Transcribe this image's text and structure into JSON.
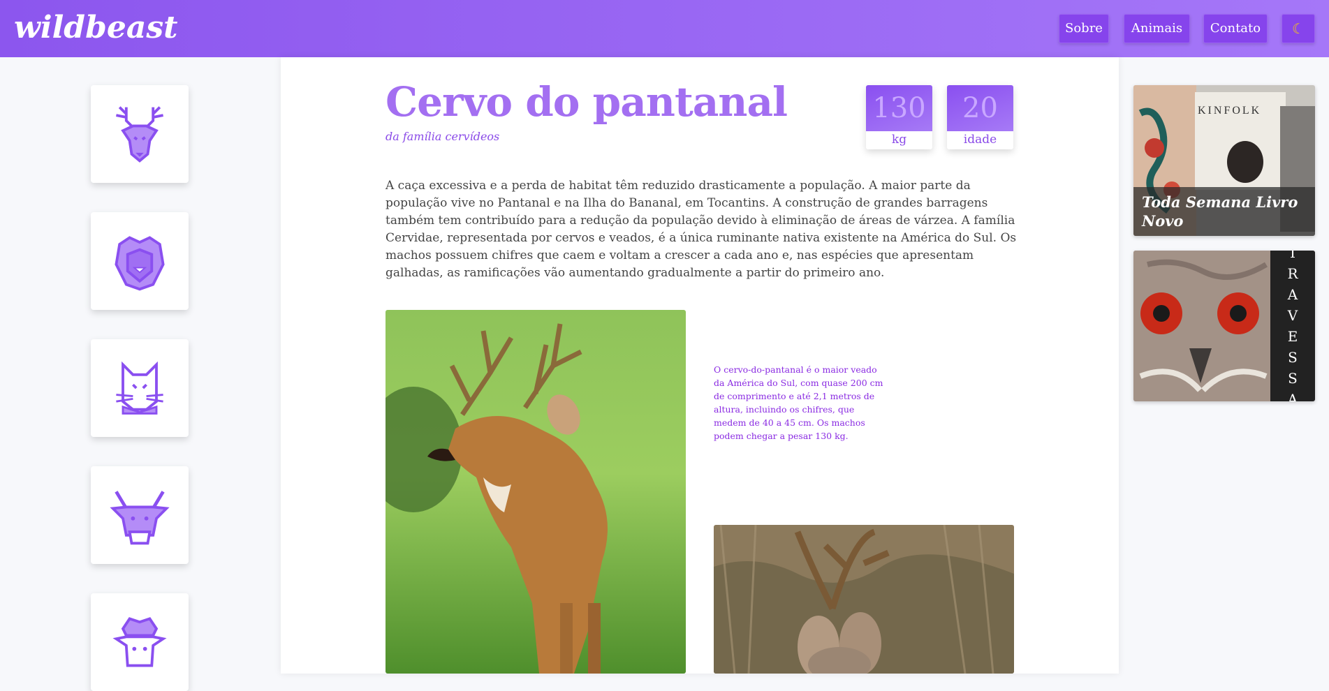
{
  "header": {
    "logo": "wildbeast",
    "nav": [
      {
        "label": "Sobre"
      },
      {
        "label": "Animais"
      },
      {
        "label": "Contato"
      }
    ],
    "theme_toggle_icon": "moon-icon",
    "colors": {
      "gradient_start": "#8c56ee",
      "gradient_end": "#a577f8",
      "accent": "#a36ff1"
    }
  },
  "sidebar": {
    "animals": [
      {
        "icon": "deer-icon"
      },
      {
        "icon": "lion-icon"
      },
      {
        "icon": "cat-icon"
      },
      {
        "icon": "bull-icon"
      },
      {
        "icon": "sheep-icon"
      }
    ]
  },
  "animal": {
    "title": "Cervo do pantanal",
    "subtitle": "da família cervídeos",
    "stats": [
      {
        "value": "130",
        "unit": "kg"
      },
      {
        "value": "20",
        "unit": "idade"
      }
    ],
    "description": "A caça excessiva e a perda de habitat têm reduzido drasticamente a população. A maior parte da população vive no Pantanal e na Ilha do Bananal, em Tocantins. A construção de grandes barragens também tem contribuído para a redução da população devido à eliminação de áreas de várzea. A família Cervidae, representada por cervos e veados, é a única ruminante nativa existente na América do Sul. Os machos possuem chifres que caem e voltam a crescer a cada ano e, nas espécies que apresentam galhadas, as ramificações vão aumentando gradualmente a partir do primeiro ano.",
    "caption": "O cervo-do-pantanal é o maior veado da América do Sul, com quase 200 cm de comprimento e até 2,1 metros de altura, incluindo os chifres, que medem de 40 a 45 cm. Os machos podem chegar a pesar 130 kg."
  },
  "ads": [
    {
      "brand": "KINFOLK",
      "caption": "Toda Semana Livro Novo"
    },
    {
      "vertical_text": [
        "T",
        "R",
        "A",
        "V",
        "E",
        "S",
        "S",
        "A"
      ]
    }
  ]
}
